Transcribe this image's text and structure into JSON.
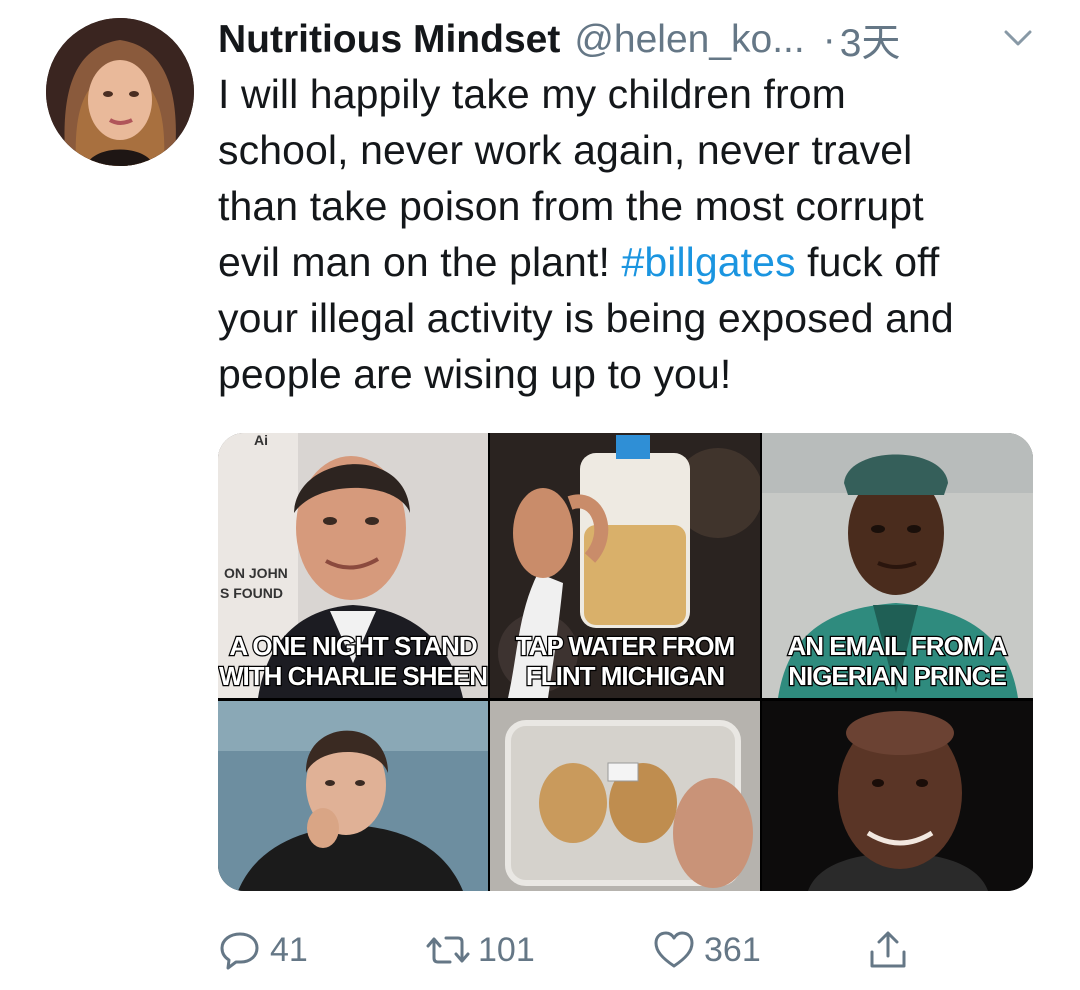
{
  "author": {
    "display_name": "Nutritious Mindset",
    "handle": "@helen_ko...",
    "separator": "·",
    "time": "3天"
  },
  "tweet": {
    "lines": [
      "I will happily take my children from",
      "school, never work again, never travel",
      "than take poison from the most corrupt"
    ],
    "line4_before": "evil man on the plant! ",
    "hashtag": "#billgates",
    "line4_after": " fuck off",
    "lines_after": [
      "your illegal activity is being exposed and",
      "people are wising up to you!"
    ]
  },
  "media": {
    "captions": [
      {
        "line1": "A ONE NIGHT STAND",
        "line2": "WITH CHARLIE SHEEN"
      },
      {
        "line1": "TAP WATER FROM",
        "line2": "FLINT MICHIGAN"
      },
      {
        "line1": "AN EMAIL FROM A",
        "line2": "NIGERIAN PRINCE"
      }
    ],
    "background_text": {
      "top": "Ai",
      "sign1": "ON JOHN",
      "sign2": "S FOUND"
    }
  },
  "actions": {
    "replies": "41",
    "retweets": "101",
    "likes": "361"
  },
  "colors": {
    "text": "#14171a",
    "secondary": "#657786",
    "link": "#1b95e0"
  },
  "icons": [
    "chevron-down-icon",
    "reply-icon",
    "retweet-icon",
    "like-icon",
    "share-icon"
  ]
}
